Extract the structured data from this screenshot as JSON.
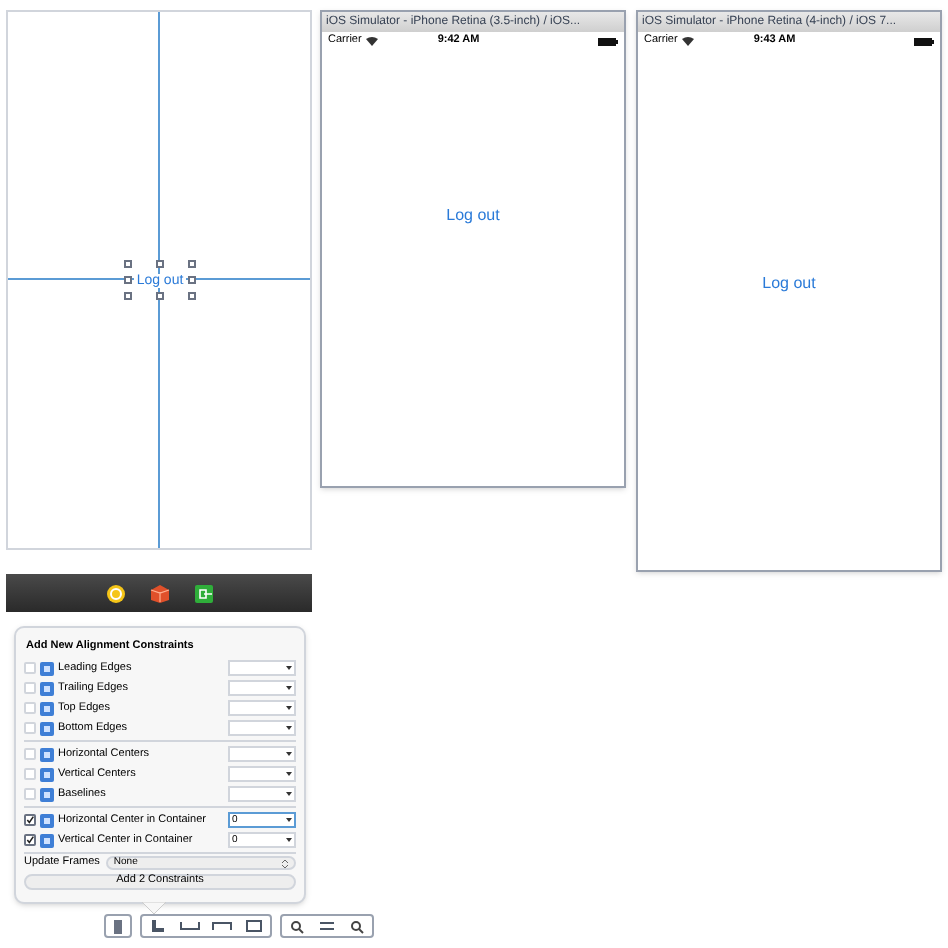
{
  "canvas": {
    "button_label": "Log out"
  },
  "simulators": [
    {
      "title": "iOS Simulator - iPhone Retina (3.5-inch) / iOS...",
      "carrier": "Carrier",
      "time": "9:42 AM",
      "button_label": "Log out"
    },
    {
      "title": "iOS Simulator - iPhone Retina (4-inch) / iOS 7...",
      "carrier": "Carrier",
      "time": "9:43 AM",
      "button_label": "Log out"
    }
  ],
  "popover": {
    "title": "Add New Alignment Constraints",
    "groups": [
      [
        {
          "label": "Leading Edges",
          "checked": false
        },
        {
          "label": "Trailing Edges",
          "checked": false
        },
        {
          "label": "Top Edges",
          "checked": false
        },
        {
          "label": "Bottom Edges",
          "checked": false
        }
      ],
      [
        {
          "label": "Horizontal Centers",
          "checked": false
        },
        {
          "label": "Vertical Centers",
          "checked": false
        },
        {
          "label": "Baselines",
          "checked": false
        }
      ],
      [
        {
          "label": "Horizontal Center in Container",
          "checked": true,
          "value": "0"
        },
        {
          "label": "Vertical Center in Container",
          "checked": true,
          "value": "0"
        }
      ]
    ],
    "update_frames": {
      "label": "Update Frames",
      "value": "None"
    },
    "add_button": "Add 2 Constraints"
  }
}
